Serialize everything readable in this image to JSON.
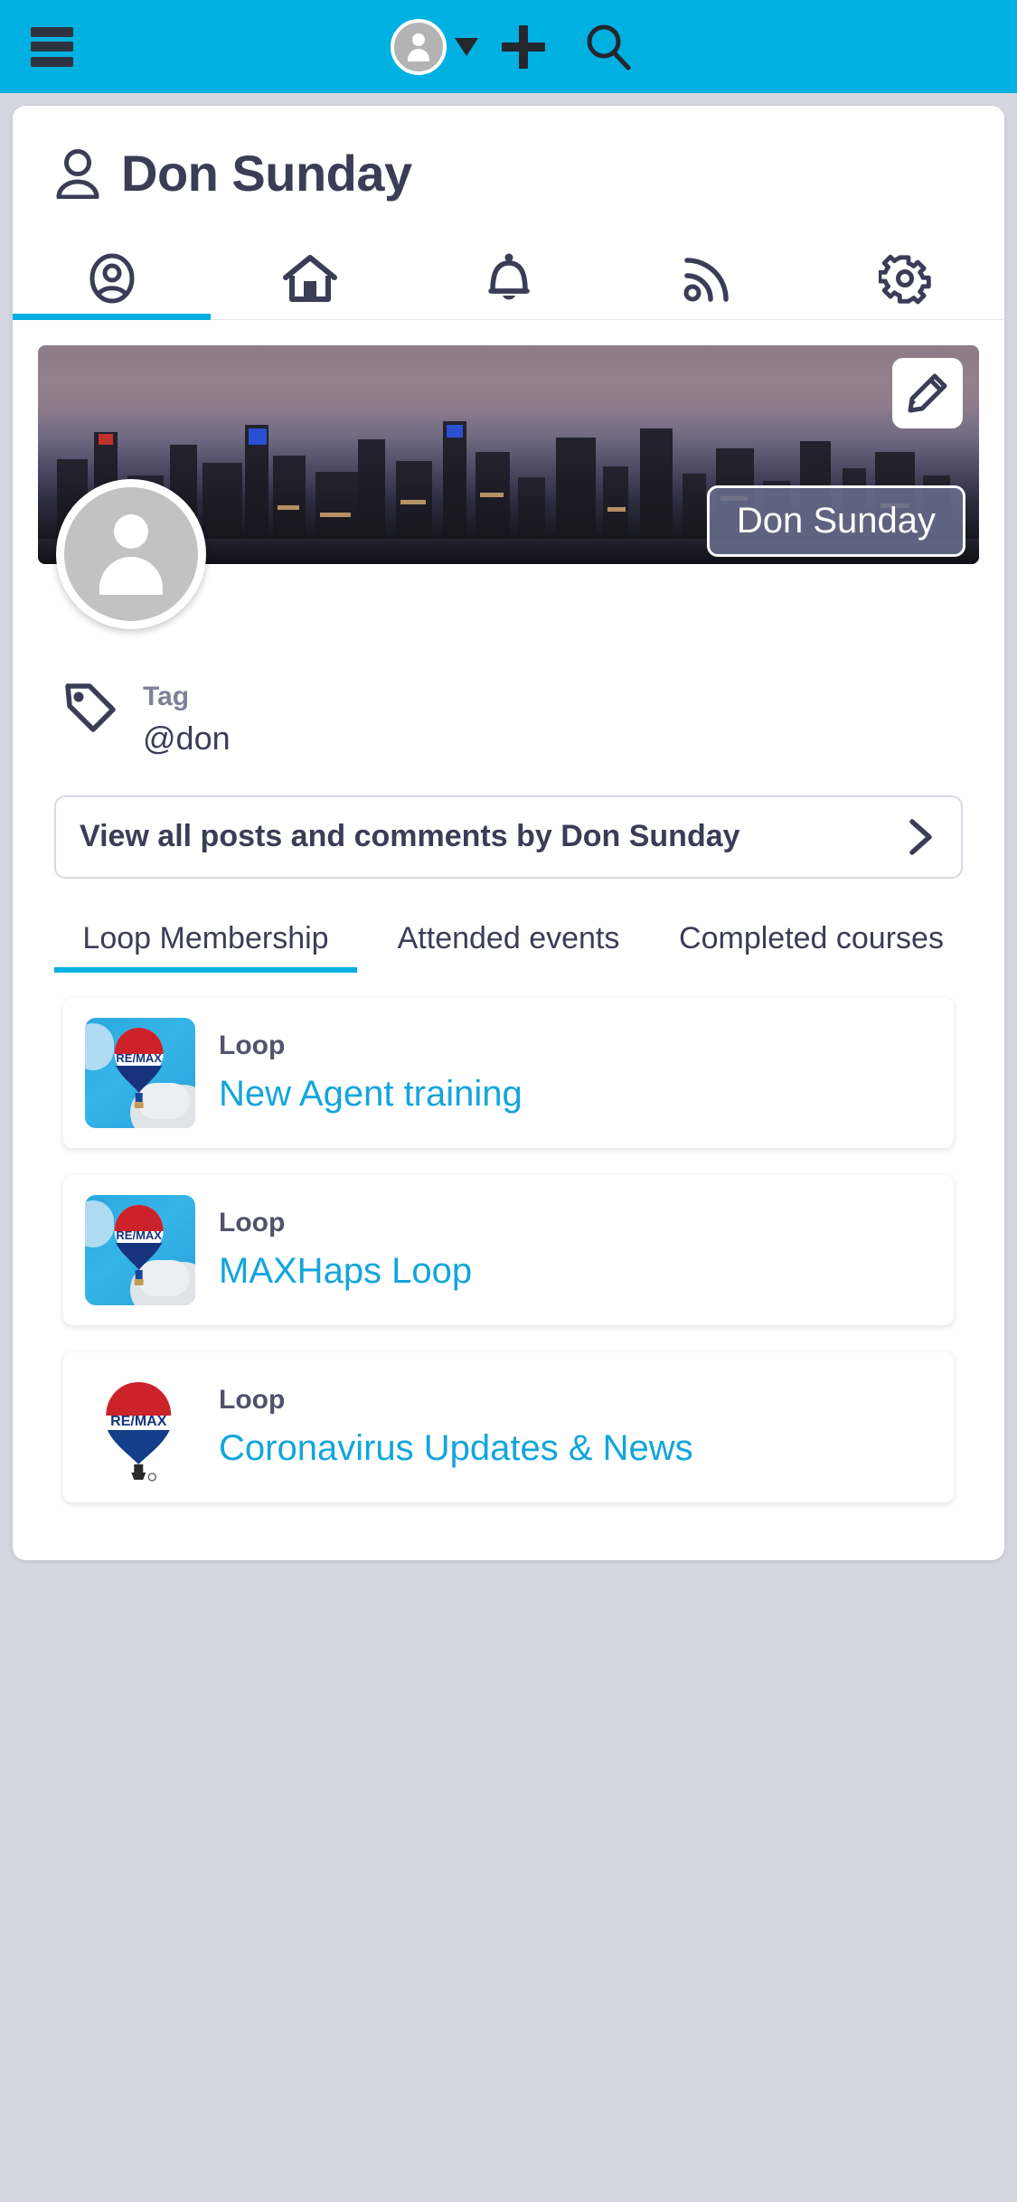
{
  "appbar": {
    "menu_icon": "hamburger-icon",
    "avatar_icon": "user-avatar-icon",
    "dropdown_icon": "caret-down-icon",
    "add_icon": "plus-icon",
    "search_icon": "search-icon",
    "background_color": "#00b0e0"
  },
  "profile": {
    "person_icon": "person-icon",
    "name": "Don Sunday",
    "cover_name_badge": "Don Sunday",
    "edit_icon": "pencil-icon",
    "avatar_icon": "user-avatar-placeholder-icon"
  },
  "icon_tabs": [
    {
      "name": "profile",
      "icon": "user-circle-icon",
      "active": true
    },
    {
      "name": "home",
      "icon": "home-icon",
      "active": false
    },
    {
      "name": "notifications",
      "icon": "bell-icon",
      "active": false
    },
    {
      "name": "feed",
      "icon": "rss-icon",
      "active": false
    },
    {
      "name": "settings",
      "icon": "gear-icon",
      "active": false
    }
  ],
  "tag": {
    "icon": "tag-icon",
    "label": "Tag",
    "value": "@don"
  },
  "view_all": {
    "label": "View all posts and comments by Don Sunday",
    "chevron_icon": "chevron-right-icon"
  },
  "text_tabs": [
    {
      "label": "Loop Membership",
      "active": true
    },
    {
      "label": "Attended events",
      "active": false
    },
    {
      "label": "Completed courses",
      "active": false
    }
  ],
  "loops": [
    {
      "kind": "Loop",
      "title": "New Agent training",
      "thumb": "remax-balloon-sky-icon"
    },
    {
      "kind": "Loop",
      "title": "MAXHaps Loop",
      "thumb": "remax-balloon-sky-icon"
    },
    {
      "kind": "Loop",
      "title": "Coronavirus Updates & News",
      "thumb": "remax-balloon-plain-icon"
    }
  ],
  "colors": {
    "accent": "#00b0e0",
    "link": "#13a5dc",
    "text_dark": "#3b3d56",
    "page_bg": "#d6d6e0"
  }
}
